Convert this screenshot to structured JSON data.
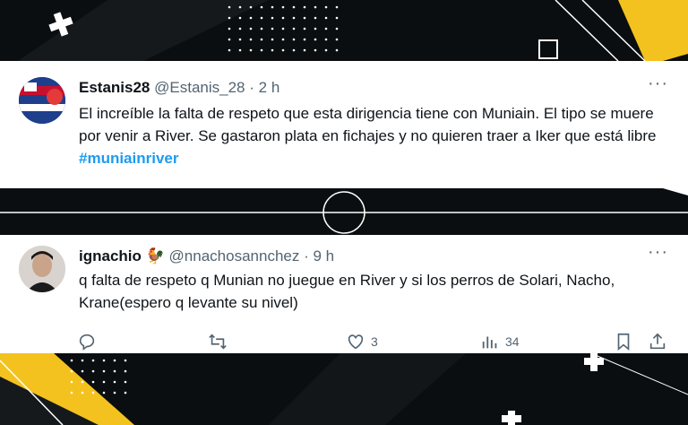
{
  "tweets": [
    {
      "name": "Estanis28",
      "handle": "@Estanis_28",
      "sep": "·",
      "time": "2 h",
      "text_before": "El increíble la falta de respeto que esta dirigencia tiene con Muniain. El tipo se muere por venir a River. Se gastaron plata en fichajes y no quieren traer a Iker que está libre ",
      "hashtag": "#muniainriver",
      "more": "···"
    },
    {
      "name": "ignachio",
      "emoji": "🐓",
      "handle": "@nnachosannchez",
      "sep": "·",
      "time": "9 h",
      "text": "q falta de respeto q Munian no juegue en River y si los perros de Solari, Nacho, Krane(espero q levante su nivel)",
      "more": "···",
      "actions": {
        "reply_icon": "reply-icon",
        "retweet_icon": "retweet-icon",
        "like_icon": "heart-icon",
        "like_count": "3",
        "views_icon": "views-icon",
        "views_count": "34",
        "bookmark_icon": "bookmark-icon",
        "share_icon": "share-icon"
      }
    }
  ],
  "colors": {
    "background": "#0b0e10",
    "accent_yellow": "#f4c21f",
    "hashtag_blue": "#1d9bf0",
    "muted_text": "#536471"
  }
}
